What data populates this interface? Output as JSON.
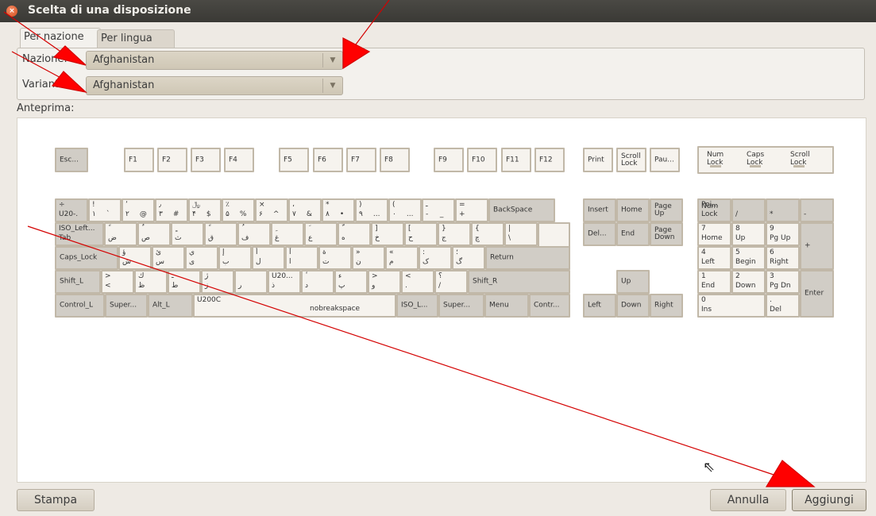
{
  "window": {
    "title": "Scelta di una disposizione",
    "close_glyph": "×"
  },
  "tabs": [
    {
      "label": "Per nazione",
      "active": true
    },
    {
      "label": "Per lingua",
      "active": false
    }
  ],
  "form": {
    "nation_label": "Nazione:",
    "nation_value": "Afghanistan",
    "variant_label": "Variante:",
    "variant_value": "Afghanistan"
  },
  "preview": {
    "label": "Anteprima:"
  },
  "keyboard": {
    "fn_row": [
      {
        "t": "Esc..."
      },
      {
        "t": "F1"
      },
      {
        "t": "F2"
      },
      {
        "t": "F3"
      },
      {
        "t": "F4"
      },
      {
        "t": "F5"
      },
      {
        "t": "F6"
      },
      {
        "t": "F7"
      },
      {
        "t": "F8"
      },
      {
        "t": "F9"
      },
      {
        "t": "F10"
      },
      {
        "t": "F11"
      },
      {
        "t": "F12"
      },
      {
        "t": "Print"
      },
      {
        "t": "Scroll\nLock"
      },
      {
        "t": "Pau..."
      }
    ],
    "lock_labels": [
      "Num\nLock",
      "Caps\nLock",
      "Scroll\nLock"
    ],
    "number_row": [
      {
        "l1": "÷",
        "l2": "U20-.",
        "r1": "",
        "r2": ""
      },
      {
        "l1": "!",
        "l2": "۱",
        "r1": "",
        "r2": "`"
      },
      {
        "l1": "٬",
        "l2": "۲",
        "r1": "",
        "r2": "@"
      },
      {
        "l1": "٫",
        "l2": "۳",
        "r1": "",
        "r2": "#"
      },
      {
        "l1": "﷼",
        "l2": "۴",
        "r1": "",
        "r2": "$"
      },
      {
        "l1": "٪",
        "l2": "۵",
        "r1": "",
        "r2": "%"
      },
      {
        "l1": "×",
        "l2": "۶",
        "r1": "",
        "r2": "^"
      },
      {
        "l1": "،",
        "l2": "۷",
        "r1": "",
        "r2": "&"
      },
      {
        "l1": "*",
        "l2": "۸",
        "r1": "",
        "r2": "•"
      },
      {
        "l1": ")",
        "l2": "۹",
        "r1": "",
        "r2": "..."
      },
      {
        "l1": "(",
        "l2": "۰",
        "r1": "",
        "r2": "..."
      },
      {
        "l1": "ـ",
        "l2": "-",
        "r1": "",
        "r2": "_"
      },
      {
        "l1": "=",
        "l2": "+",
        "r1": "",
        "r2": ""
      }
    ],
    "backspace": "BackSpace",
    "tab_key": {
      "l1": "ISO_Left...",
      "l2": "Tab"
    },
    "q_row": [
      {
        "l1": "ً",
        "l2": "ض"
      },
      {
        "l1": "ٌ",
        "l2": "ص"
      },
      {
        "l1": "ٍ",
        "l2": "ث"
      },
      {
        "l1": "ً",
        "l2": "ق"
      },
      {
        "l1": "ُ",
        "l2": "ف"
      },
      {
        "l1": "ِ",
        "l2": "غ"
      },
      {
        "l1": "َ",
        "l2": "ع"
      },
      {
        "l1": "ّ",
        "l2": "ه"
      },
      {
        "l1": "]",
        "l2": "خ"
      },
      {
        "l1": "[",
        "l2": "ح"
      },
      {
        "l1": "}",
        "l2": "ج"
      },
      {
        "l1": "{",
        "l2": "چ"
      },
      {
        "l1": "|",
        "l2": "\\"
      }
    ],
    "caps": "Caps_Lock",
    "a_row": [
      {
        "l1": "ؤ",
        "l2": "ش"
      },
      {
        "l1": "ئ",
        "l2": "س"
      },
      {
        "l1": "ي",
        "l2": "ی"
      },
      {
        "l1": "إ",
        "l2": "ب"
      },
      {
        "l1": "أ",
        "l2": "ل"
      },
      {
        "l1": "آ",
        "l2": "ا"
      },
      {
        "l1": "ة",
        "l2": "ت"
      },
      {
        "l1": "»",
        "l2": "ن"
      },
      {
        "l1": "«",
        "l2": "م"
      },
      {
        "l1": ":",
        "l2": "ک"
      },
      {
        "l1": "؛",
        "l2": "گ"
      }
    ],
    "return": "Return",
    "shift_l": "Shift_L",
    "z_row": [
      {
        "l1": ">",
        "l2": "<"
      },
      {
        "l1": "ك",
        "l2": "ظ"
      },
      {
        "l1": "ـ",
        "l2": "ط"
      },
      {
        "l1": "ژ",
        "l2": "ز"
      },
      {
        "l1": "",
        "l2": "ر"
      },
      {
        "l1": "U20...",
        "l2": "ذ"
      },
      {
        "l1": "ٔ",
        "l2": "د"
      },
      {
        "l1": "ء",
        "l2": "پ"
      },
      {
        "l1": ">",
        "l2": "و"
      },
      {
        "l1": "<",
        "l2": "."
      },
      {
        "l1": "؟",
        "l2": "/"
      }
    ],
    "shift_r": "Shift_R",
    "bottom_row": [
      "Control_L",
      "Super...",
      "Alt_L",
      "U200C",
      "nobreakspace",
      "ISO_L...",
      "Super...",
      "Menu",
      "Contr..."
    ],
    "nav_top": [
      "Insert",
      "Home",
      "Page\nUp"
    ],
    "nav_mid": [
      "Del...",
      "End",
      "Page\nDown"
    ],
    "arrows": [
      "Up",
      "Left",
      "Down",
      "Right"
    ],
    "numpad": [
      {
        "l1": "Poi...",
        "l2": "Num\nLock"
      },
      {
        "l1": "",
        "l2": "/"
      },
      {
        "l1": "",
        "l2": "*"
      },
      {
        "l1": "",
        "l2": "-"
      },
      {
        "l1": "7",
        "l2": "Home"
      },
      {
        "l1": "8",
        "l2": "Up"
      },
      {
        "l1": "9",
        "l2": "Pg Up"
      },
      {
        "l1": "",
        "l2": "+"
      },
      {
        "l1": "4",
        "l2": "Left"
      },
      {
        "l1": "5",
        "l2": "Begin"
      },
      {
        "l1": "6",
        "l2": "Right"
      },
      {
        "l1": "1",
        "l2": "End"
      },
      {
        "l1": "2",
        "l2": "Down"
      },
      {
        "l1": "3",
        "l2": "Pg Dn"
      },
      {
        "l1": "",
        "l2": "Enter"
      },
      {
        "l1": "0",
        "l2": "Ins"
      },
      {
        "l1": ".",
        "l2": "Del"
      }
    ]
  },
  "buttons": {
    "print": "Stampa",
    "cancel": "Annulla",
    "add": "Aggiungi"
  }
}
